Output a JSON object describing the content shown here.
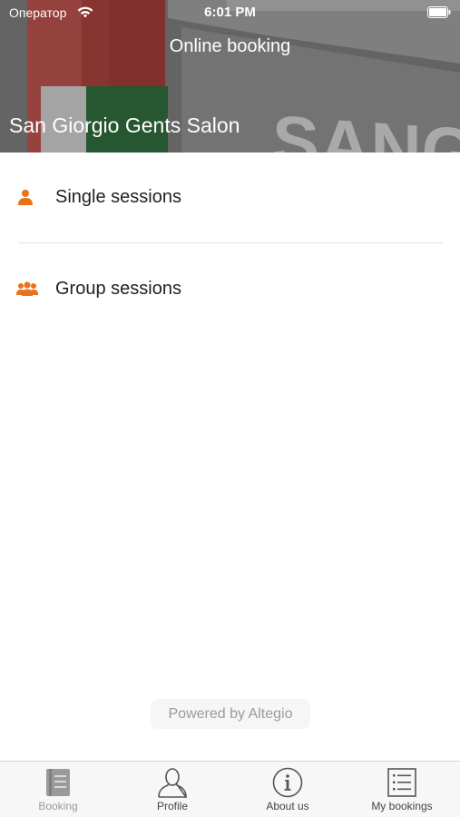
{
  "status_bar": {
    "carrier": "Оператор",
    "time": "6:01 PM"
  },
  "header": {
    "nav_title": "Online booking",
    "salon_name": "San Giorgio Gents Salon",
    "background_sign_text": "SANGIORG"
  },
  "menu": {
    "items": [
      {
        "label": "Single sessions",
        "icon": "person-icon"
      },
      {
        "label": "Group sessions",
        "icon": "group-icon"
      }
    ]
  },
  "footer": {
    "powered_by": "Powered by Altegio"
  },
  "tabbar": {
    "tabs": [
      {
        "label": "Booking",
        "icon": "booking-icon",
        "selected": true
      },
      {
        "label": "Profile",
        "icon": "profile-icon",
        "selected": false
      },
      {
        "label": "About us",
        "icon": "info-icon",
        "selected": false
      },
      {
        "label": "My bookings",
        "icon": "list-icon",
        "selected": false
      }
    ]
  },
  "colors": {
    "accent": "#e8731c",
    "tab_inactive": "#9a9a9a",
    "divider": "#e2e2e2"
  }
}
